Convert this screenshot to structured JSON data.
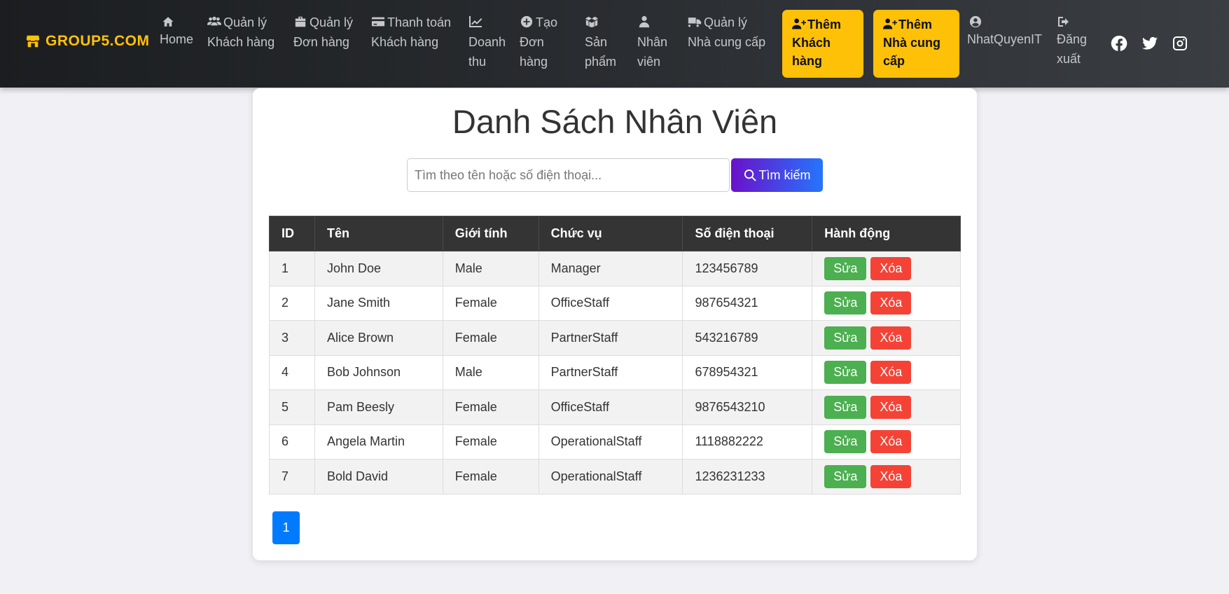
{
  "brand": {
    "name": "GROUP5.COM",
    "icon": "store-icon"
  },
  "nav": {
    "home": [
      "Home"
    ],
    "customers": [
      "Quản lý",
      "Khách hàng"
    ],
    "orders": [
      "Quản lý",
      "Đơn hàng"
    ],
    "payments": [
      "Thanh toán",
      "Khách hàng"
    ],
    "revenue": [
      "Doanh",
      "thu"
    ],
    "create_order": [
      "Tạo",
      "Đơn",
      "hàng"
    ],
    "products": [
      "Sản",
      "phẩm"
    ],
    "staff": [
      "Nhân",
      "viên"
    ],
    "suppliers": [
      "Quản lý",
      "Nhà cung cấp"
    ],
    "add_customer": [
      "Thêm",
      "Khách",
      "hàng"
    ],
    "add_supplier": [
      "Thêm",
      "Nhà cung",
      "cấp"
    ],
    "user": [
      "NhatQuyenIT"
    ],
    "logout": [
      "Đăng",
      "xuất"
    ]
  },
  "social": [
    "facebook-icon",
    "twitter-icon",
    "instagram-icon"
  ],
  "page": {
    "title": "Danh Sách Nhân Viên"
  },
  "search": {
    "placeholder": "Tìm theo tên hoặc số điện thoại...",
    "value": "",
    "button_label": "Tìm kiếm"
  },
  "table": {
    "headers": [
      "ID",
      "Tên",
      "Giới tính",
      "Chức vụ",
      "Số điện thoại",
      "Hành động"
    ],
    "rows": [
      [
        "1",
        "John Doe",
        "Male",
        "Manager",
        "123456789"
      ],
      [
        "2",
        "Jane Smith",
        "Female",
        "OfficeStaff",
        "987654321"
      ],
      [
        "3",
        "Alice Brown",
        "Female",
        "PartnerStaff",
        "543216789"
      ],
      [
        "4",
        "Bob Johnson",
        "Male",
        "PartnerStaff",
        "678954321"
      ],
      [
        "5",
        "Pam Beesly",
        "Female",
        "OfficeStaff",
        "9876543210"
      ],
      [
        "6",
        "Angela Martin",
        "Female",
        "OperationalStaff",
        "1118882222"
      ],
      [
        "7",
        "Bold David",
        "Female",
        "OperationalStaff",
        "1236231233"
      ]
    ],
    "edit_label": "Sửa",
    "delete_label": "Xóa"
  },
  "pagination": {
    "current": "1"
  },
  "colors": {
    "brand": "#ffc107",
    "navbar": "#2d3034",
    "edit": "#4caf50",
    "delete": "#f44336",
    "page_active": "#007bff",
    "search_start": "#6a11cb",
    "search_end": "#2575fc"
  }
}
